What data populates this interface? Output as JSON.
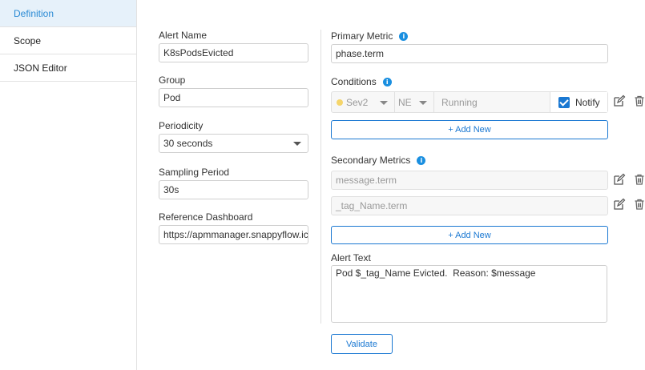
{
  "sidebar": {
    "items": [
      {
        "label": "Definition",
        "active": true
      },
      {
        "label": "Scope",
        "active": false
      },
      {
        "label": "JSON Editor",
        "active": false
      }
    ]
  },
  "form": {
    "alert_name": {
      "label": "Alert Name",
      "value": "K8sPodsEvicted"
    },
    "group": {
      "label": "Group",
      "value": "Pod"
    },
    "periodicity": {
      "label": "Periodicity",
      "value": "30 seconds"
    },
    "sampling_period": {
      "label": "Sampling Period",
      "value": "30s"
    },
    "reference_dashboard": {
      "label": "Reference Dashboard",
      "value": "https://apmmanager.snappyflow.ic"
    }
  },
  "primary_metric": {
    "label": "Primary Metric",
    "value": "phase.term"
  },
  "conditions": {
    "label": "Conditions",
    "severity": "Sev2",
    "operator": "NE",
    "value_placeholder": "Running",
    "notify_label": "Notify",
    "notify_checked": true,
    "add_new": "+ Add New"
  },
  "secondary_metrics": {
    "label": "Secondary Metrics",
    "items": [
      {
        "value": "message.term"
      },
      {
        "value": "_tag_Name.term"
      }
    ],
    "add_new": "+ Add New"
  },
  "alert_text": {
    "label": "Alert Text",
    "value": "Pod $_tag_Name Evicted.  Reason: $message"
  },
  "validate_label": "Validate",
  "colors": {
    "accent": "#1a78d2",
    "active_bg": "#e6f1fa",
    "sev2": "#f5d56b"
  }
}
